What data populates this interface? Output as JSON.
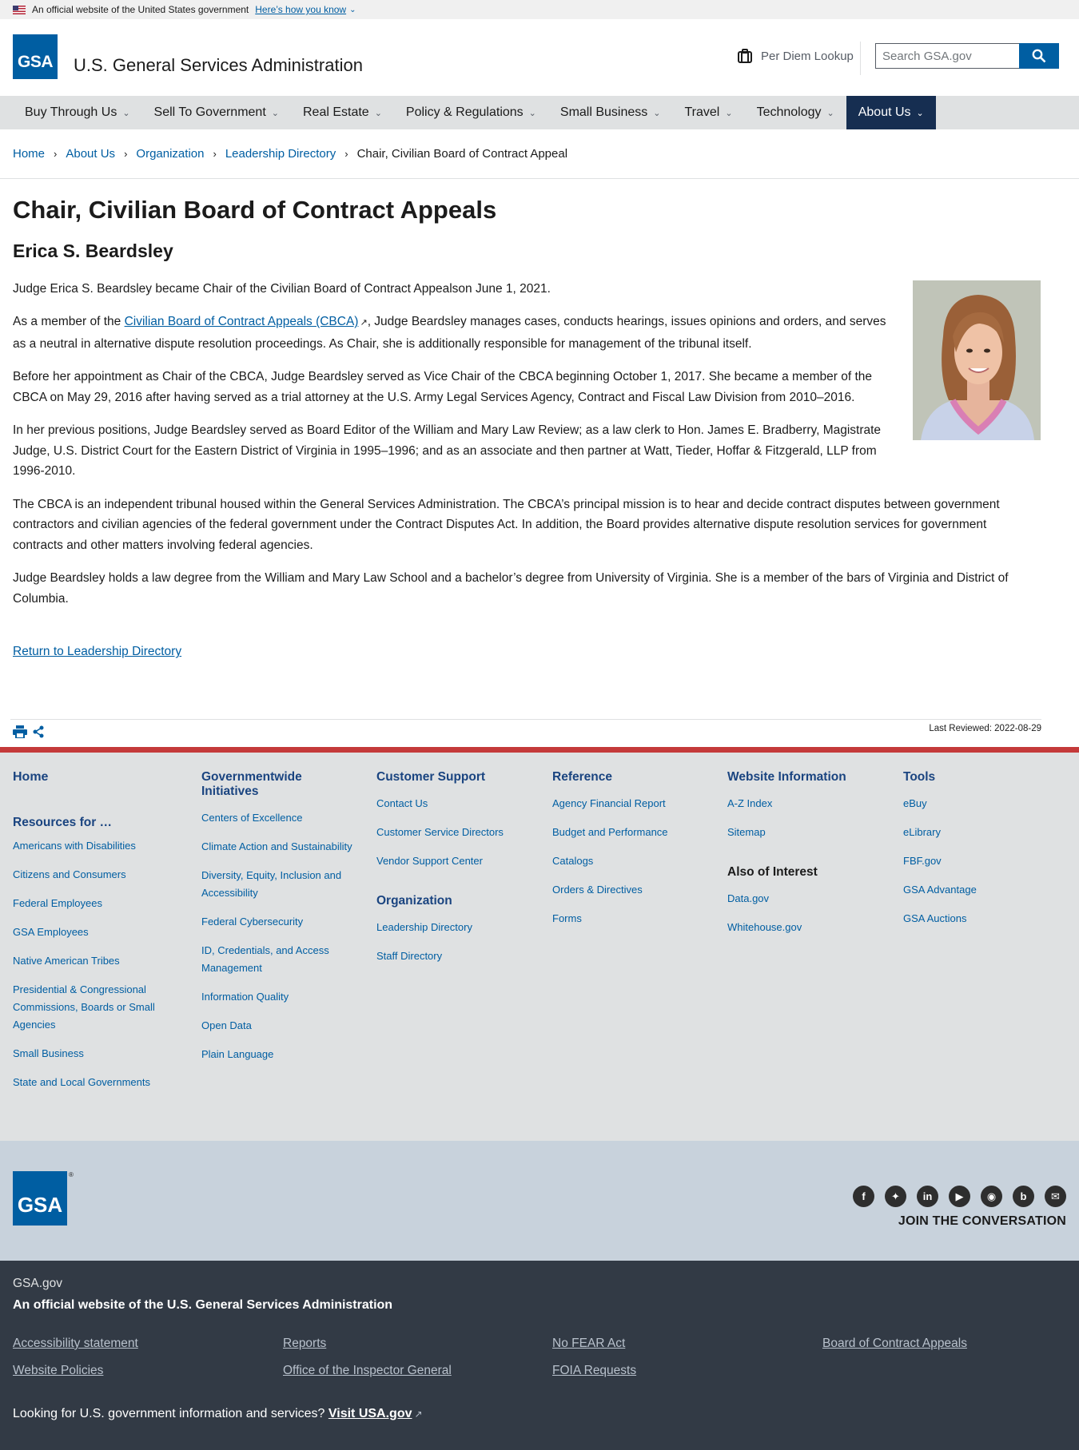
{
  "gov_banner": {
    "text": "An official website of the United States government",
    "how_link": "Here’s how you know"
  },
  "header": {
    "logo_text": "GSA",
    "site_title": "U.S. General Services Administration",
    "per_diem": "Per Diem Lookup",
    "search_placeholder": "Search GSA.gov"
  },
  "nav": {
    "items": [
      {
        "label": "Buy Through Us"
      },
      {
        "label": "Sell To Government"
      },
      {
        "label": "Real Estate"
      },
      {
        "label": "Policy & Regulations"
      },
      {
        "label": "Small Business"
      },
      {
        "label": "Travel"
      },
      {
        "label": "Technology"
      },
      {
        "label": "About Us"
      }
    ]
  },
  "breadcrumb": {
    "items": [
      "Home",
      "About Us",
      "Organization",
      "Leadership Directory"
    ],
    "current": "Chair, Civilian Board of Contract Appeal"
  },
  "main": {
    "title": "Chair, Civilian Board of Contract Appeals",
    "name": "Erica S. Beardsley",
    "p1": "Judge Erica S. Beardsley became Chair of the Civilian Board of Contract Appealson June 1, 2021.",
    "p2_before": "As a member of the ",
    "p2_link": "Civilian Board of Contract Appeals (CBCA)",
    "p2_after": ", Judge Beardsley manages cases, conducts hearings, issues opinions and orders, and serves as a neutral in alternative dispute resolution proceedings. As Chair, she is additionally responsible for management of the tribunal itself.",
    "p3": "Before her appointment as Chair of the CBCA, Judge Beardsley served as Vice Chair of the CBCA beginning October 1, 2017. She became a member of the CBCA on May 29, 2016 after having served as a trial attorney at the U.S. Army Legal Services Agency, Contract and Fiscal Law Division from 2010–2016.",
    "p4": "In her previous positions, Judge Beardsley served as Board Editor of the William and Mary Law Review; as a law clerk to Hon. James E. Bradberry, Magistrate Judge, U.S. District Court for the Eastern District of Virginia in 1995–1996; and as an associate and then partner at Watt, Tieder, Hoffar & Fitzgerald, LLP from 1996-2010.",
    "p5": "The CBCA is an independent tribunal housed within the General Services Administration. The CBCA’s principal mission is to hear and decide contract disputes between government contractors and civilian agencies of the federal government under the Contract Disputes Act. In addition, the Board provides alternative dispute resolution services for government contracts and other matters involving federal agencies.",
    "p6": "Judge Beardsley holds a law degree from the William and Mary Law School and a bachelor’s degree from University of Virginia. She is a member of the bars of Virginia and District of Columbia.",
    "return_link": "Return to Leadership Directory",
    "last_reviewed": "Last Reviewed: 2022-08-29"
  },
  "footer": {
    "home": "Home",
    "resources_heading": "Resources for …",
    "resources": [
      "Americans with Disabilities",
      "Citizens and Consumers",
      "Federal Employees",
      "GSA Employees",
      "Native American Tribes",
      "Presidential & Congressional Commissions, Boards or Small Agencies",
      "Small Business",
      "State and Local Governments"
    ],
    "gov_heading": "Governmentwide Initiatives",
    "gov_links": [
      "Centers of Excellence",
      "Climate Action and Sustainability",
      "Diversity, Equity, Inclusion and Accessibility",
      "Federal Cybersecurity",
      "ID, Credentials, and Access Management",
      "Information Quality",
      "Open Data",
      "Plain Language"
    ],
    "support_heading": "Customer Support",
    "support_links": [
      "Contact Us",
      "Customer Service Directors",
      "Vendor Support Center"
    ],
    "org_heading": "Organization",
    "org_links": [
      "Leadership Directory",
      "Staff Directory"
    ],
    "reference_heading": "Reference",
    "reference_links": [
      "Agency Financial Report",
      "Budget and Performance",
      "Catalogs",
      "Orders & Directives",
      "Forms"
    ],
    "website_heading": "Website Information",
    "website_links": [
      "A-Z Index",
      "Sitemap"
    ],
    "interest_heading": "Also of Interest",
    "interest_links": [
      "Data.gov",
      "Whitehouse.gov"
    ],
    "tools_heading": "Tools",
    "tools_links": [
      "eBuy",
      "eLibrary",
      "FBF.gov",
      "GSA Advantage",
      "GSA Auctions"
    ],
    "logo_text": "GSA",
    "join": "JOIN THE CONVERSATION",
    "social_icons": [
      "facebook-icon",
      "twitter-icon",
      "linkedin-icon",
      "youtube-icon",
      "instagram-icon",
      "blog-icon",
      "email-icon"
    ],
    "gsagov": "GSA.gov",
    "official": "An official website of the U.S. General Services Administration",
    "identity_links": [
      "Accessibility statement",
      "Reports",
      "No FEAR Act",
      "Board of Contract Appeals",
      "Website Policies",
      "Office of the Inspector General",
      "FOIA Requests"
    ],
    "usa_text": "Looking for U.S. government information and services?",
    "usa_link": "Visit USA.gov"
  },
  "colors": {
    "primary": "#005ea2",
    "nav_active": "#162e51",
    "footer_dark": "#323a45",
    "accent_red": "#b50909"
  }
}
